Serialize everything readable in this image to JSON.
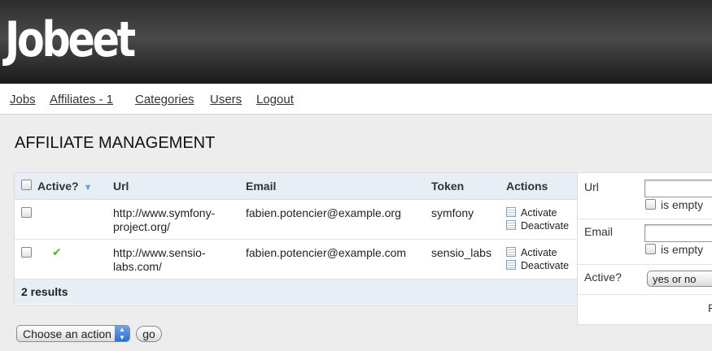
{
  "header": {
    "logo": "Jobeet"
  },
  "menu": [
    {
      "label": "Jobs"
    },
    {
      "label": "Affiliates - 1"
    },
    {
      "label": "Categories"
    },
    {
      "label": "Users"
    },
    {
      "label": "Logout"
    }
  ],
  "page": {
    "title": "AFFILIATE MANAGEMENT"
  },
  "table": {
    "columns": [
      "Active?",
      "Url",
      "Email",
      "Token",
      "Actions"
    ],
    "rows": [
      {
        "active": false,
        "url": "http://www.symfony-project.org/",
        "url_line1": "http://www.symfony-",
        "url_line2": "project.org/",
        "email": "fabien.potencier@example.org",
        "token": "symfony",
        "actions": [
          "Activate",
          "Deactivate"
        ]
      },
      {
        "active": true,
        "url": "http://www.sensio-labs.com/",
        "url_line1": "http://www.sensio-",
        "url_line2": "labs.com/",
        "email": "fabien.potencier@example.com",
        "token": "sensio_labs",
        "actions": [
          "Activate",
          "Deactivate"
        ]
      }
    ],
    "footer": "2 results"
  },
  "filters": {
    "url_label": "Url",
    "email_label": "Email",
    "is_empty_label": "is empty",
    "active_label": "Active?",
    "active_selected": "yes or no",
    "reset_label": "R"
  },
  "batch": {
    "select_selected": "Choose an action",
    "go_label": "go"
  },
  "colors": {
    "header_bg": "#2d2d2d",
    "table_header_bg": "#e8eef5",
    "active_check": "#58b52a"
  }
}
